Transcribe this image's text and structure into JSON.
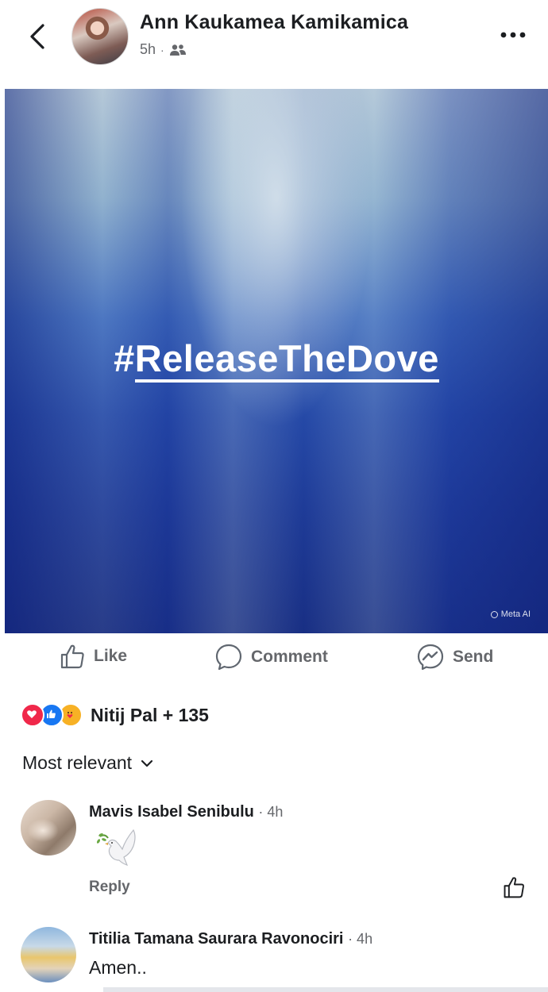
{
  "header": {
    "back_icon": "chevron-left-icon",
    "poster_name": "Ann Kaukamea Kamikamica",
    "time": "5h",
    "separator": "·",
    "audience_icon": "friends-icon",
    "more_icon": "more-horizontal-icon"
  },
  "post": {
    "hashtag_prefix": "#",
    "hashtag_text": "ReleaseTheDove",
    "watermark": "Meta AI",
    "colors": {
      "deep_blue": "#14267a",
      "mid_blue": "#3f6bbd",
      "light": "#b9cad7"
    }
  },
  "actions": [
    {
      "label": "Like",
      "icon": "thumbs-up-icon"
    },
    {
      "label": "Comment",
      "icon": "comment-bubble-icon"
    },
    {
      "label": "Send",
      "icon": "messenger-icon"
    }
  ],
  "reactions": {
    "icons": [
      "love-reaction-icon",
      "like-reaction-icon",
      "care-reaction-icon"
    ],
    "summary": "Nitij Pal + 135"
  },
  "sort": {
    "label": "Most relevant",
    "icon": "chevron-down-icon"
  },
  "comments": [
    {
      "name": "Mavis Isabel Senibulu",
      "time": "· 4h",
      "content_icon": "dove-emoji-icon",
      "reply_label": "Reply"
    },
    {
      "name": "Titilia Tamana Saurara Ravonociri",
      "time": "· 4h",
      "text": "Amen.."
    }
  ]
}
